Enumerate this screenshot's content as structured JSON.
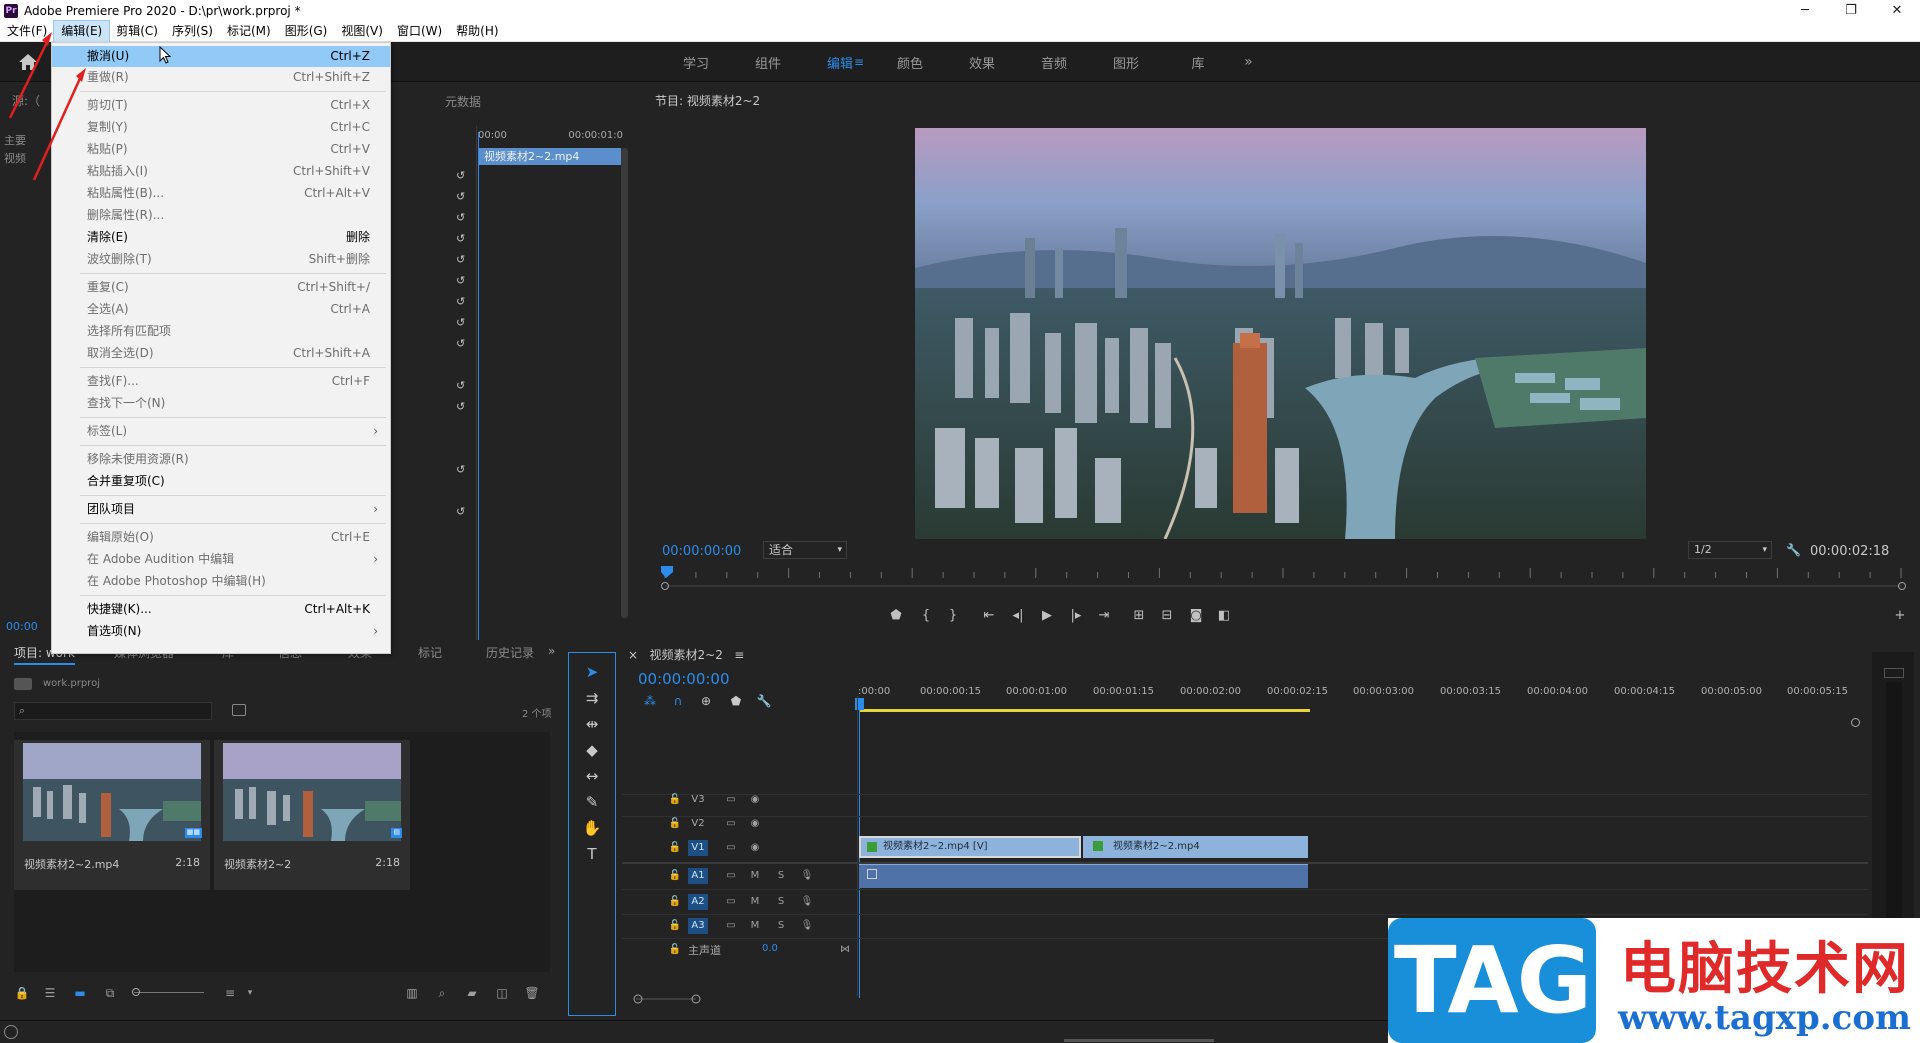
{
  "window": {
    "app_icon": "Pr",
    "title": "Adobe Premiere Pro 2020 - D:\\pr\\work.prproj *",
    "controls": [
      "─",
      "❐",
      "✕"
    ]
  },
  "menubar": {
    "items": [
      "文件(F)",
      "编辑(E)",
      "剪辑(C)",
      "序列(S)",
      "标记(M)",
      "图形(G)",
      "视图(V)",
      "窗口(W)",
      "帮助(H)"
    ]
  },
  "workspace": {
    "tabs": [
      "学习",
      "组件",
      "编辑",
      "颜色",
      "效果",
      "音频",
      "图形",
      "库"
    ],
    "active": "编辑",
    "more": "»"
  },
  "edit_menu": {
    "items": [
      {
        "label": "撤消(U)",
        "shortcut": "Ctrl+Z",
        "state": "highlight"
      },
      {
        "label": "重做(R)",
        "shortcut": "Ctrl+Shift+Z",
        "state": "disabled"
      },
      {
        "label": "剪切(T)",
        "shortcut": "Ctrl+X",
        "state": "disabled"
      },
      {
        "label": "复制(Y)",
        "shortcut": "Ctrl+C",
        "state": "disabled"
      },
      {
        "label": "粘贴(P)",
        "shortcut": "Ctrl+V",
        "state": "disabled"
      },
      {
        "label": "粘贴插入(I)",
        "shortcut": "Ctrl+Shift+V",
        "state": "disabled"
      },
      {
        "label": "粘贴属性(B)...",
        "shortcut": "Ctrl+Alt+V",
        "state": "disabled"
      },
      {
        "label": "删除属性(R)...",
        "shortcut": "",
        "state": "disabled"
      },
      {
        "label": "清除(E)",
        "shortcut": "删除",
        "state": "enabled"
      },
      {
        "label": "波纹删除(T)",
        "shortcut": "Shift+删除",
        "state": "disabled"
      },
      {
        "label": "重复(C)",
        "shortcut": "Ctrl+Shift+/",
        "state": "disabled"
      },
      {
        "label": "全选(A)",
        "shortcut": "Ctrl+A",
        "state": "disabled"
      },
      {
        "label": "选择所有匹配项",
        "shortcut": "",
        "state": "disabled"
      },
      {
        "label": "取消全选(D)",
        "shortcut": "Ctrl+Shift+A",
        "state": "disabled"
      },
      {
        "label": "查找(F)...",
        "shortcut": "Ctrl+F",
        "state": "disabled"
      },
      {
        "label": "查找下一个(N)",
        "shortcut": "",
        "state": "disabled"
      },
      {
        "label": "标签(L)",
        "shortcut": "",
        "state": "disabled",
        "submenu": true
      },
      {
        "label": "移除未使用资源(R)",
        "shortcut": "",
        "state": "disabled"
      },
      {
        "label": "合并重复项(C)",
        "shortcut": "",
        "state": "enabled"
      },
      {
        "label": "团队项目",
        "shortcut": "",
        "state": "enabled",
        "submenu": true
      },
      {
        "label": "编辑原始(O)",
        "shortcut": "Ctrl+E",
        "state": "disabled"
      },
      {
        "label": "在 Adobe Audition 中编辑",
        "shortcut": "",
        "state": "disabled",
        "submenu": true
      },
      {
        "label": "在 Adobe Photoshop 中编辑(H)",
        "shortcut": "",
        "state": "disabled"
      },
      {
        "label": "快捷键(K)...",
        "shortcut": "Ctrl+Alt+K",
        "state": "enabled"
      },
      {
        "label": "首选项(N)",
        "shortcut": "",
        "state": "enabled",
        "submenu": true
      }
    ]
  },
  "effect_controls": {
    "tab_partial": "源:（",
    "meta_tab": "元数据",
    "left_labels": [
      "主要",
      "视频"
    ],
    "ruler_start": "00:00",
    "ruler_end": "00:00:01:0",
    "clip_name": "视频素材2~2.mp4",
    "bottom_time": "00:00"
  },
  "program_monitor": {
    "title": "节目: 视频素材2~2",
    "current_time": "00:00:00:00",
    "fit": "适合",
    "resolution": "1/2",
    "duration": "00:00:02:18"
  },
  "project": {
    "tabs": [
      "项目: work",
      "媒体浏览器",
      "库",
      "信息",
      "效果",
      "标记",
      "历史记录"
    ],
    "file": "work.prproj",
    "count": "2 个项",
    "items": [
      {
        "name": "视频素材2~2.mp4",
        "duration": "2:18"
      },
      {
        "name": "视频素材2~2",
        "duration": "2:18"
      }
    ]
  },
  "timeline": {
    "sequence_name": "视频素材2~2",
    "current_time": "00:00:00:00",
    "ruler": [
      ":00:00",
      "00:00:00:15",
      "00:00:01:00",
      "00:00:01:15",
      "00:00:02:00",
      "00:00:02:15",
      "00:00:03:00",
      "00:00:03:15",
      "00:00:04:00",
      "00:00:04:15",
      "00:00:05:00",
      "00:00:05:15"
    ],
    "video_tracks": [
      "V3",
      "V2",
      "V1"
    ],
    "audio_tracks": [
      "A1",
      "A2",
      "A3"
    ],
    "master_label": "主声道",
    "master_value": "0.0",
    "clips": {
      "v1a": "视频素材2~2.mp4 [V]",
      "v1b": "视频素材2~2.mp4"
    }
  },
  "watermark": {
    "badge": "TAG",
    "title": "电脑技术网",
    "url": "www.tagxp.com"
  },
  "colors": {
    "accent": "#2d8ceb",
    "menu_highlight": "#91c9f7",
    "clip_video": "#8db3dc",
    "clip_audio": "#4f72a8",
    "in_out_bar": "#e7d53a",
    "annotation": "#e02020"
  }
}
